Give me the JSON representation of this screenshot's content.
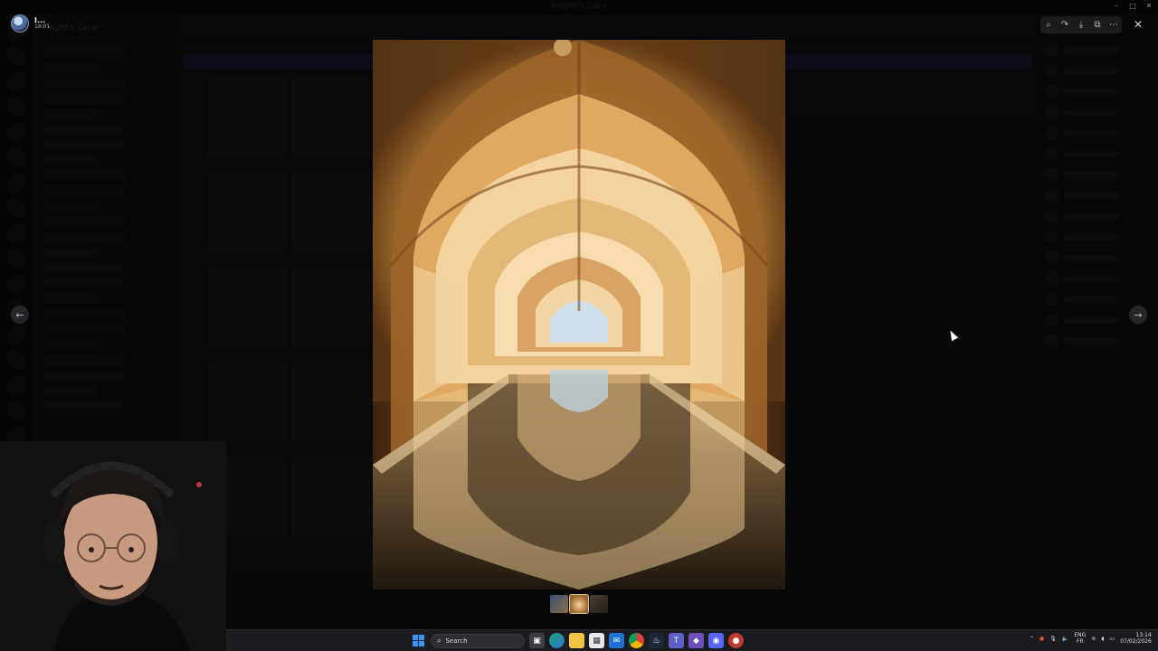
{
  "window": {
    "title": "Knight's Cave"
  },
  "background_app": {
    "server_name": "Knight's Cave",
    "channel_name": "",
    "dimmed": true
  },
  "viewer": {
    "uploader": {
      "name": "I...",
      "time": "18:01"
    },
    "toolbar": [
      {
        "name": "zoom-icon",
        "glyph": "⌕"
      },
      {
        "name": "forward-icon",
        "glyph": "↷"
      },
      {
        "name": "download-icon",
        "glyph": "⤓"
      },
      {
        "name": "open-external-icon",
        "glyph": "⧉"
      },
      {
        "name": "more-icon",
        "glyph": "⋯"
      }
    ],
    "close_glyph": "✕",
    "prev_glyph": "←",
    "next_glyph": "→",
    "image_subject": "vaulted arches reflected in pool",
    "thumbnail_count": 3,
    "active_thumbnail_index": 1
  },
  "taskbar": {
    "search_placeholder": "Search",
    "apps": [
      "task-view-icon",
      "edge-icon",
      "file-explorer-icon",
      "calendar-icon",
      "mail-icon",
      "chrome-icon",
      "steam-icon",
      "teams-icon",
      "app-icon",
      "discord-icon",
      "app-icon-2"
    ],
    "language": {
      "line1": "ENG",
      "line2": "FR"
    },
    "clock": {
      "time": "13:14",
      "date": "07/02/2026"
    }
  },
  "colors": {
    "accent": "#5865f2",
    "taskbar_bg": "#1c1c20",
    "windows_blue": "#3a96ff"
  }
}
